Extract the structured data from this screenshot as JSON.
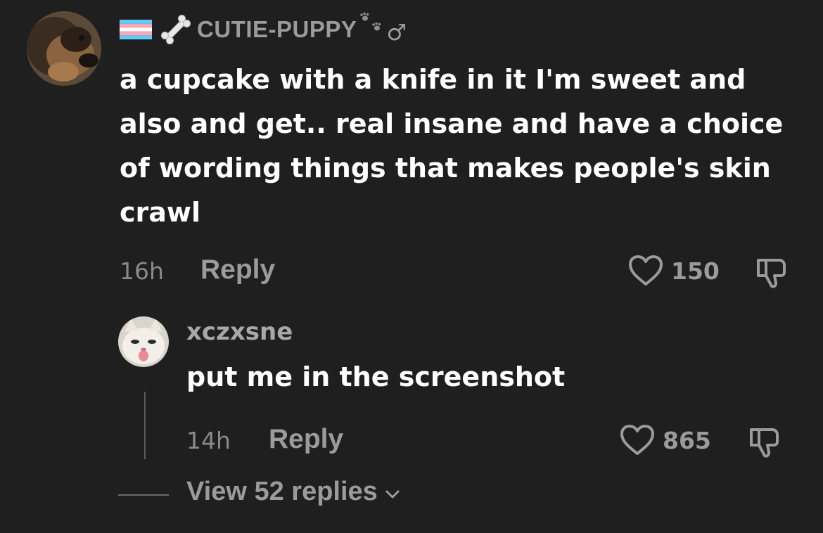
{
  "comment": {
    "username": "CUTIE-PUPPY",
    "text": "a cupcake with a knife in it I'm sweet and also and get.. real insane and have a choice of wording things that makes people's skin crawl",
    "time": "16h",
    "reply_label": "Reply",
    "likes": "150",
    "badges": [
      "transgender-flag-icon",
      "bone-icon",
      "paw-prints-icon",
      "male-sign-icon"
    ],
    "male_symbol": "♂"
  },
  "reply": {
    "username": "xczxsne",
    "text": "put me in the screenshot",
    "time": "14h",
    "reply_label": "Reply",
    "likes": "865"
  },
  "view_replies": {
    "label": "View 52 replies"
  },
  "colors": {
    "background": "#1f1f1f",
    "primary_text": "#ffffff",
    "secondary_text": "#9b9b9b",
    "trans_blue": "#5bcefa",
    "trans_pink": "#f5a9b8"
  }
}
